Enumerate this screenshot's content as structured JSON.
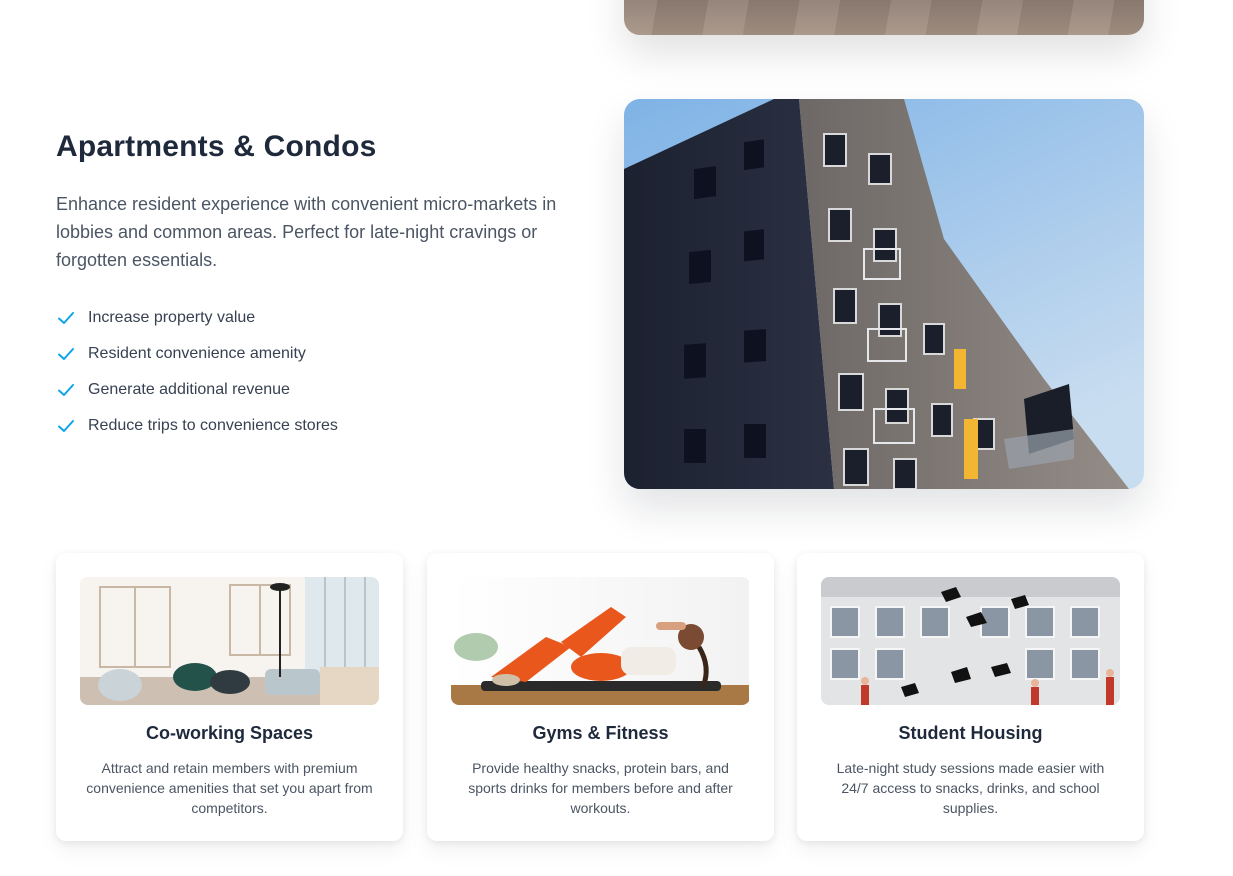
{
  "apartments": {
    "title": "Apartments & Condos",
    "description": "Enhance resident experience with convenient micro-markets in lobbies and common areas. Perfect for late-night cravings or forgotten essentials.",
    "features": [
      "Increase property value",
      "Resident convenience amenity",
      "Generate additional revenue",
      "Reduce trips to convenience stores"
    ],
    "check_icon": "check-icon",
    "accent_color": "#0ea5e9"
  },
  "cards": [
    {
      "title": "Co-working Spaces",
      "description": "Attract and retain members with premium convenience amenities that set you apart from competitors."
    },
    {
      "title": "Gyms & Fitness",
      "description": "Provide healthy snacks, protein bars, and sports drinks for members before and after workouts."
    },
    {
      "title": "Student Housing",
      "description": "Late-night study sessions made easier with 24/7 access to snacks, drinks, and school supplies."
    }
  ]
}
